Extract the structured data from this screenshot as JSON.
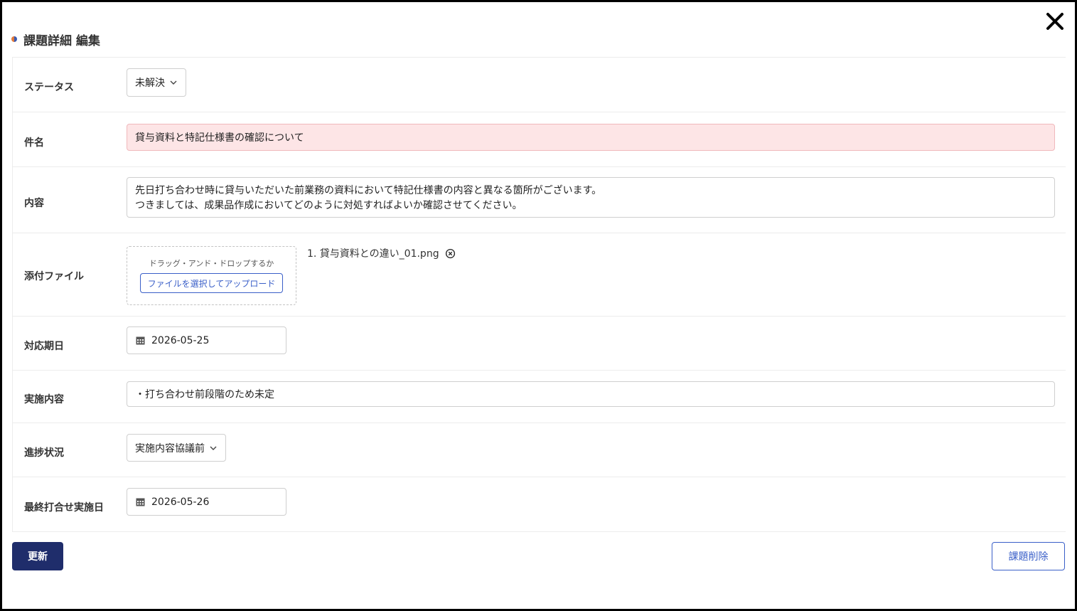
{
  "dialog": {
    "title": "課題詳細 編集",
    "close_icon": "close-icon"
  },
  "fields": {
    "status": {
      "label": "ステータス",
      "value": "未解決"
    },
    "subject": {
      "label": "件名",
      "value": "貸与資料と特記仕様書の確認について"
    },
    "content": {
      "label": "内容",
      "line1": "先日打ち合わせ時に貸与いただいた前業務の資料において特記仕様書の内容と異なる箇所がございます。",
      "line2": "つきましては、成果品作成においてどのように対処すればよいか確認させてください。"
    },
    "attachment": {
      "label": "添付ファイル",
      "drop_hint": "ドラッグ・アンド・ドロップするか",
      "upload_label": "ファイルを選択してアップロード",
      "files": [
        "1. 貸与資料との違い_01.png"
      ]
    },
    "due_date": {
      "label": "対応期日",
      "value": "2026-05-25"
    },
    "action": {
      "label": "実施内容",
      "value": "・打ち合わせ前段階のため未定"
    },
    "progress": {
      "label": "進捗状況",
      "value": "実施内容協議前"
    },
    "last_meeting": {
      "label": "最終打合せ実施日",
      "value": "2026-05-26"
    }
  },
  "buttons": {
    "update": "更新",
    "delete": "課題削除"
  },
  "colors": {
    "primary": "#1f2d6b",
    "link": "#3a5fc8",
    "error_bg": "#fde5e6"
  }
}
